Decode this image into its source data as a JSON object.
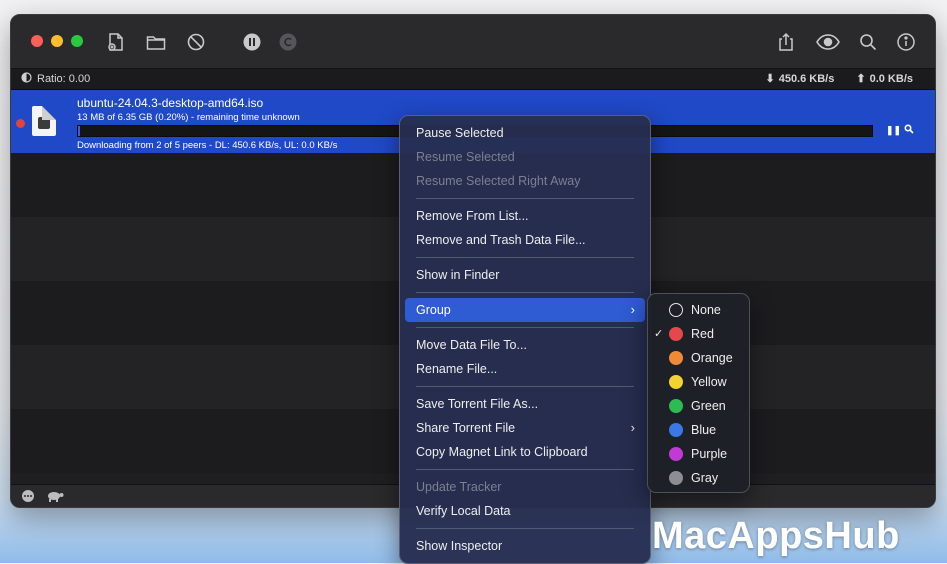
{
  "status": {
    "ratio": "Ratio: 0.00",
    "download_rate": "450.6 KB/s",
    "upload_rate": "0.0 KB/s"
  },
  "torrent": {
    "name": "ubuntu-24.04.3-desktop-amd64.iso",
    "progress_text": "13 MB of 6.35 GB (0.20%) - remaining time unknown",
    "peers_text": "Downloading from 2 of 5 peers - DL: 450.6 KB/s, UL: 0.0 KB/s",
    "progress_percent": 0.2
  },
  "context_menu": {
    "items": [
      {
        "label": "Pause Selected",
        "enabled": true
      },
      {
        "label": "Resume Selected",
        "enabled": false
      },
      {
        "label": "Resume Selected Right Away",
        "enabled": false
      },
      {
        "label": "Remove From List...",
        "enabled": true
      },
      {
        "label": "Remove and Trash Data File...",
        "enabled": true
      },
      {
        "label": "Show in Finder",
        "enabled": true
      },
      {
        "label": "Group",
        "enabled": true,
        "highlighted": true,
        "submenu": true
      },
      {
        "label": "Move Data File To...",
        "enabled": true
      },
      {
        "label": "Rename File...",
        "enabled": true
      },
      {
        "label": "Save Torrent File As...",
        "enabled": true
      },
      {
        "label": "Share Torrent File",
        "enabled": true,
        "submenu": true
      },
      {
        "label": "Copy Magnet Link to Clipboard",
        "enabled": true
      },
      {
        "label": "Update Tracker",
        "enabled": false
      },
      {
        "label": "Verify Local Data",
        "enabled": true
      },
      {
        "label": "Show Inspector",
        "enabled": true
      }
    ]
  },
  "group_submenu": {
    "items": [
      {
        "label": "None",
        "color": "none",
        "checked": false
      },
      {
        "label": "Red",
        "color": "#e5474b",
        "checked": true
      },
      {
        "label": "Orange",
        "color": "#f08a37",
        "checked": false
      },
      {
        "label": "Yellow",
        "color": "#f2d331",
        "checked": false
      },
      {
        "label": "Green",
        "color": "#2dbb52",
        "checked": false
      },
      {
        "label": "Blue",
        "color": "#3a78e8",
        "checked": false
      },
      {
        "label": "Purple",
        "color": "#c23ad6",
        "checked": false
      },
      {
        "label": "Gray",
        "color": "#8d8d92",
        "checked": false
      }
    ]
  },
  "watermark": "MacAppsHub"
}
